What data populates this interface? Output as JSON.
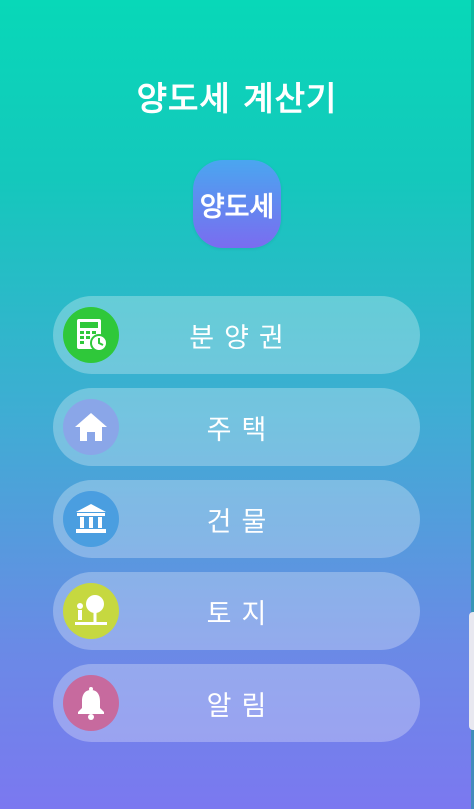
{
  "app": {
    "title": "양도세 계산기",
    "logo_text": "양도세"
  },
  "menu": {
    "items": [
      {
        "label": "분양권",
        "icon": "calculator-icon",
        "icon_color": "#2fc83a"
      },
      {
        "label": "주택",
        "icon": "house-icon",
        "icon_color": "#8aa6e8"
      },
      {
        "label": "건물",
        "icon": "bank-icon",
        "icon_color": "#4a9ee0"
      },
      {
        "label": "토지",
        "icon": "land-icon",
        "icon_color": "#c6d840"
      },
      {
        "label": "알림",
        "icon": "bell-icon",
        "icon_color": "#c76a9e"
      }
    ]
  },
  "colors": {
    "bg_top": "#08d8b8",
    "bg_bottom": "#7b78f0",
    "logo_top": "#4aa6f0",
    "logo_bottom": "#7a6cf0"
  }
}
